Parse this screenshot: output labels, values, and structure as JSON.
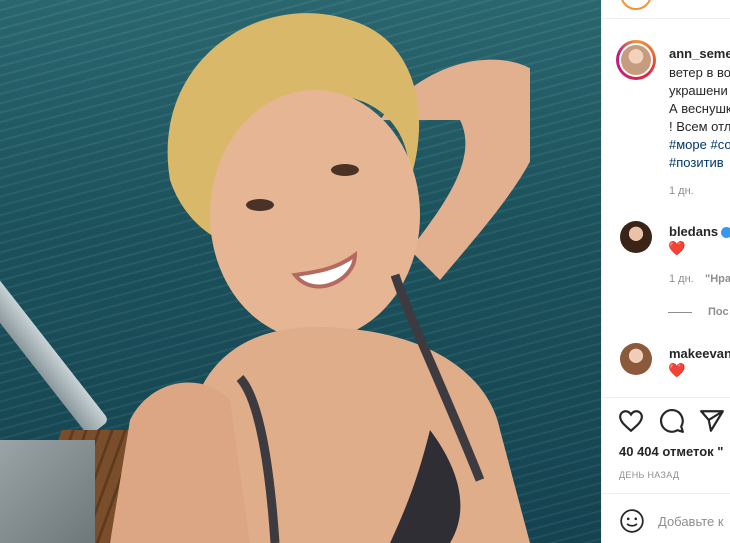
{
  "post": {
    "author": "ann_seme",
    "caption_lines": [
      "ветер в во",
      "украшени",
      "А веснушк",
      "! Всем отл"
    ],
    "hashtags_lines": [
      "#море #со",
      "#позитив"
    ],
    "time_ago": "1 дн."
  },
  "comments": [
    {
      "username": "bledans",
      "verified": true,
      "text": "❤️",
      "time_ago": "1 дн.",
      "like_label": "\"Нра",
      "view_replies": "Пос"
    },
    {
      "username": "makeevan",
      "text": "❤️"
    }
  ],
  "actions": {
    "icons": [
      "heart-icon",
      "comment-icon",
      "share-icon"
    ]
  },
  "likes": "40 404 отметок \"",
  "date": "ДЕНЬ НАЗАД",
  "add_comment": {
    "placeholder": "Добавьте к"
  },
  "colors": {
    "link": "#00376b",
    "heart": "#ed4956",
    "muted": "#8e8e8e",
    "verified": "#3897f0"
  }
}
